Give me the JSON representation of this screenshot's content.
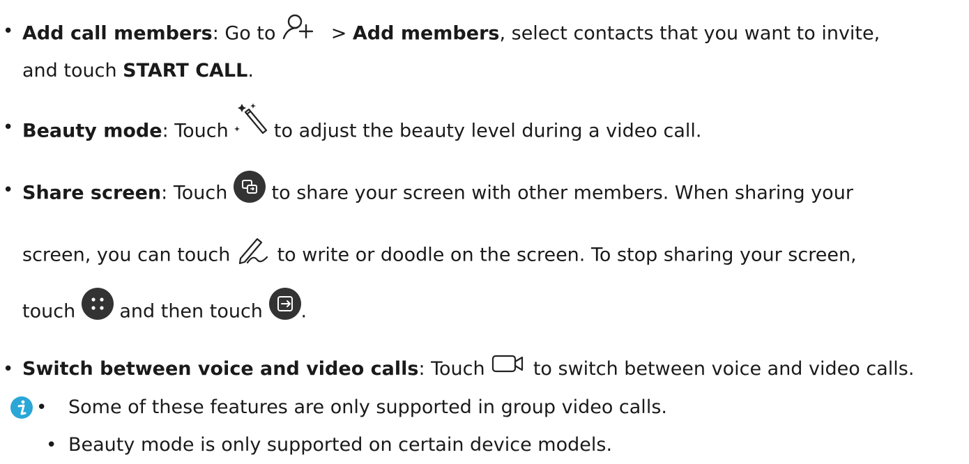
{
  "items": [
    {
      "title": "Add call members",
      "seg1": ": Go to ",
      "seg2": " > ",
      "strong2": "Add members",
      "seg3": ", select contacts that you want to invite,",
      "line2_pre": "and touch ",
      "strong3": "START CALL",
      "line2_post": ".",
      "icon": "add-person-icon"
    },
    {
      "title": "Beauty mode",
      "seg1": ": Touch ",
      "seg2": " to adjust the beauty level during a video call.",
      "icon": "magic-wand-icon"
    },
    {
      "title": "Share screen",
      "seg1": ": Touch ",
      "seg2": " to share your screen with other members. When sharing your",
      "line2_pre": "screen, you can touch ",
      "line2_post": " to write or doodle on the screen. To stop sharing your screen,",
      "line3_pre": "touch ",
      "line3_mid": " and then touch ",
      "line3_post": ".",
      "icons": [
        "share-screen-icon",
        "doodle-pen-icon",
        "more-dots-icon",
        "exit-share-icon"
      ]
    },
    {
      "title": "Switch between voice and video calls",
      "seg1": ": Touch ",
      "seg2": " to switch between voice and video calls.",
      "icon": "video-camera-icon"
    }
  ],
  "notes": [
    "Some of these features are only supported in group video calls.",
    "Beauty mode is only supported on certain device models."
  ],
  "colors": {
    "text": "#1a1a1a",
    "icon_dark": "#333333",
    "info_accent": "#2aa7d6"
  }
}
